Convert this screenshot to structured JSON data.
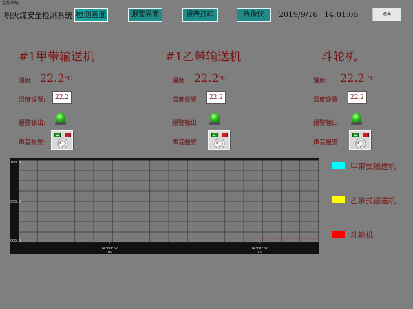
{
  "window": {
    "title": "监控系统"
  },
  "app_title": "明火煤安全检测系统",
  "nav": [
    {
      "label": "检测画面",
      "active": true
    },
    {
      "label": "报警界面",
      "active": false
    },
    {
      "label": "报表打印",
      "active": false
    },
    {
      "label": "热像仪",
      "active": false
    }
  ],
  "date": "2019/9/16",
  "time": "14:01:06",
  "exit_label": "退出",
  "labels": {
    "temperature": "温度:",
    "setpoint": "温度设置:",
    "alarm_output": "报警输出:",
    "sound_alarm": "声音报警:"
  },
  "panels": [
    {
      "title": "#1甲带输送机",
      "temperature": "22.2",
      "unit": "℃",
      "setpoint": "22.2",
      "alarm_led": "green"
    },
    {
      "title": "#1乙带输送机",
      "temperature": "22.2",
      "unit": "℃",
      "setpoint": "22.2",
      "alarm_led": "green"
    },
    {
      "title": "斗轮机",
      "temperature": "22.2",
      "unit": "℃",
      "setpoint": "22.2",
      "alarm_led": "green"
    }
  ],
  "chart_data": {
    "type": "line",
    "ylim": [
      0,
      100
    ],
    "ytick_labels": [
      "100.0",
      "050.0",
      "000.0"
    ],
    "xtick_labels": [
      {
        "time": "14:00:52",
        "day": "16"
      },
      {
        "time": "14:01:02",
        "day": "16"
      }
    ],
    "grid": true,
    "series": [
      {
        "name": "甲带式输送机",
        "color": "#00ffff",
        "values": []
      },
      {
        "name": "乙带式输送机",
        "color": "#ffff00",
        "values": []
      },
      {
        "name": "斗轮机",
        "color": "#ff0000",
        "values": []
      }
    ]
  }
}
